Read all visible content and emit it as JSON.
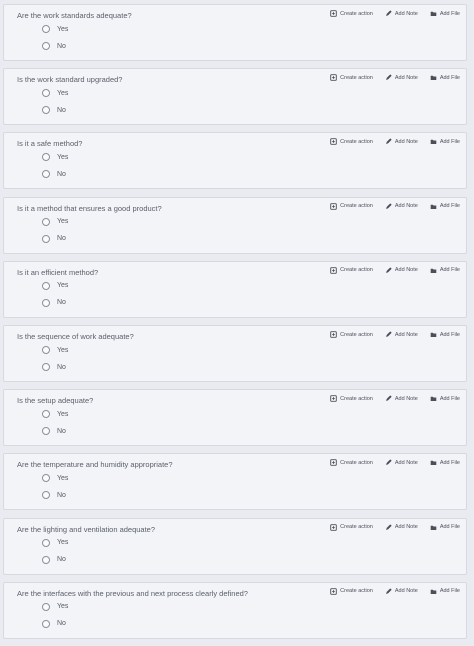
{
  "actions": {
    "create_action": "Create action",
    "add_note": "Add Note",
    "add_file": "Add File"
  },
  "options": {
    "yes": "Yes",
    "no": "No"
  },
  "questions": [
    "Are the work standards adequate?",
    "Is the work standard upgraded?",
    "Is it a safe method?",
    "Is it a method that ensures a good product?",
    "Is it an efficient method?",
    "Is the sequence of work adequate?",
    "Is the setup adequate?",
    "Are the temperature and humidity appropriate?",
    "Are the lighting and ventilation adequate?",
    "Are the interfaces with the previous and next process clearly defined?"
  ]
}
